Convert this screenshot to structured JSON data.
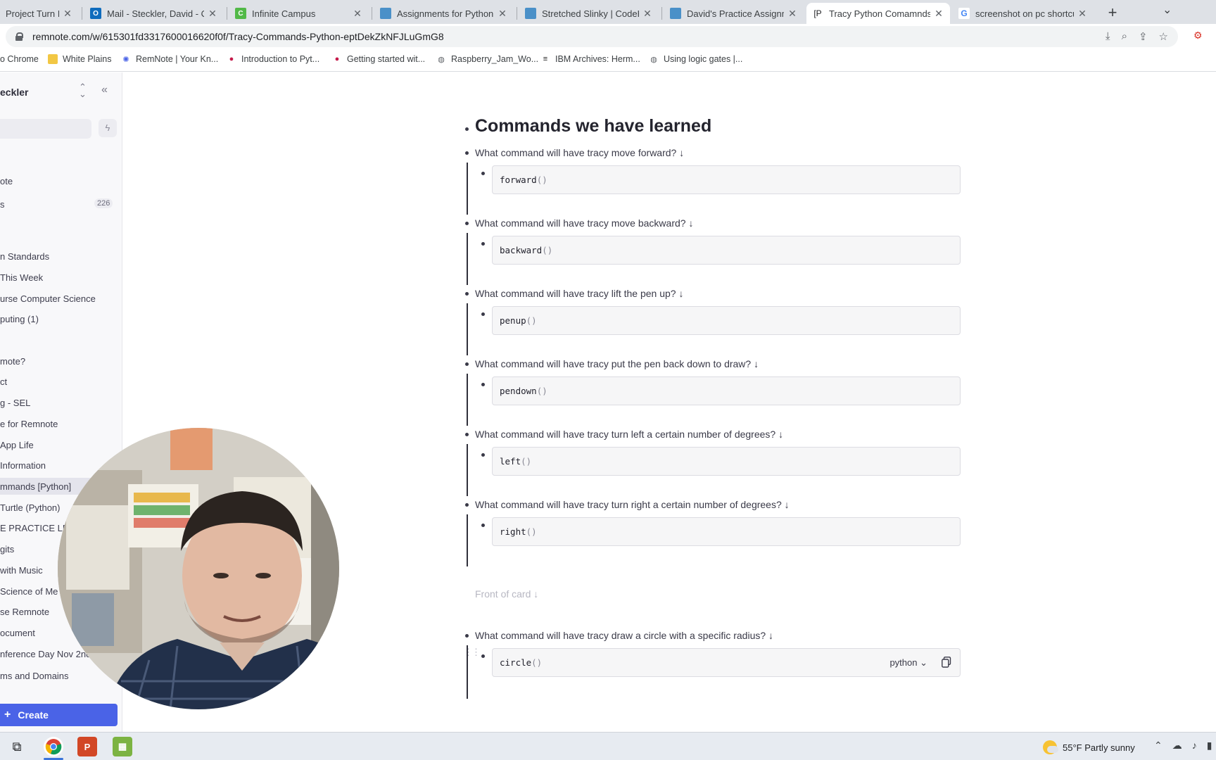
{
  "browser": {
    "tabs": [
      {
        "label": "Project Turn IN (P",
        "color": "#ffffff"
      },
      {
        "label": "Mail - Steckler, David - Out",
        "color": "#0f6cbd"
      },
      {
        "label": "Infinite Campus",
        "color": "#52b948"
      },
      {
        "label": "Assignments for Python - (",
        "color": "#4a90c8"
      },
      {
        "label": "Stretched Slinky | CodeHS",
        "color": "#4a90c8"
      },
      {
        "label": "David's Practice Assignmen",
        "color": "#4a90c8"
      },
      {
        "label": "Tracy Python Comamnds",
        "color": "#202124"
      },
      {
        "label": "screenshot on pc shortcut",
        "color": "#4285f4"
      }
    ],
    "url": "remnote.com/w/615301fd3317600016620f0f/Tracy-Commands-Python-eptDekZkNFJLuGmG8",
    "bookmarks": [
      {
        "label": "o Chrome",
        "icon": ""
      },
      {
        "label": "White Plains",
        "icon": "folder-icon"
      },
      {
        "label": "RemNote | Your Kn...",
        "icon": "remnote-icon"
      },
      {
        "label": "Introduction to Pyt...",
        "icon": "raspberry-icon"
      },
      {
        "label": "Getting started wit...",
        "icon": "raspberry-icon"
      },
      {
        "label": "Raspberry_Jam_Wo...",
        "icon": "globe-icon"
      },
      {
        "label": "IBM Archives: Herm...",
        "icon": "ibm-icon"
      },
      {
        "label": "Using logic gates |...",
        "icon": "globe-icon"
      }
    ]
  },
  "sidebar": {
    "user": "eckler",
    "count": "226",
    "items": [
      {
        "label": "ote"
      },
      {
        "label": "s"
      },
      {
        "label": "n Standards"
      },
      {
        "label": "This Week"
      },
      {
        "label": "urse Computer Science"
      },
      {
        "label": "puting (1)"
      },
      {
        "label": "mote?"
      },
      {
        "label": "ct"
      },
      {
        "label": "g - SEL"
      },
      {
        "label": "e for Remnote"
      },
      {
        "label": "App Life"
      },
      {
        "label": "Information"
      },
      {
        "label": "mmands [Python]"
      },
      {
        "label": "Turtle (Python)"
      },
      {
        "label": "E PRACTICE LES"
      },
      {
        "label": "gits"
      },
      {
        "label": "with Music"
      },
      {
        "label": "Science of Me"
      },
      {
        "label": "se Remnote"
      },
      {
        "label": "ocument"
      },
      {
        "label": "nference Day Nov 2nd"
      },
      {
        "label": "ms and Domains"
      }
    ],
    "create_label": "Create"
  },
  "document": {
    "title": "Commands we have learned",
    "cards": [
      {
        "question": "What command will have tracy move forward? ↓",
        "code": "forward",
        "paren": "()"
      },
      {
        "question": "What command will have tracy move backward? ↓",
        "code": "backward",
        "paren": "()"
      },
      {
        "question": "What command will have tracy lift the pen up? ↓",
        "code": "penup",
        "paren": "()"
      },
      {
        "question": "What command will have tracy put the pen back down to draw? ↓",
        "code": "pendown",
        "paren": "()"
      },
      {
        "question": "What command will have tracy turn left a certain number of degrees? ↓",
        "code": "left",
        "paren": "()"
      },
      {
        "question": "What command will have tracy turn right a certain number of degrees? ↓",
        "code": "right",
        "paren": "()"
      }
    ],
    "placeholder_front": "Front of card ↓",
    "last_card": {
      "question": "What command will have tracy draw a circle with a specific radius? ↓",
      "code": "circle",
      "paren": "()",
      "language": "python ⌄"
    }
  },
  "taskbar": {
    "weather": "55°F  Partly sunny"
  }
}
